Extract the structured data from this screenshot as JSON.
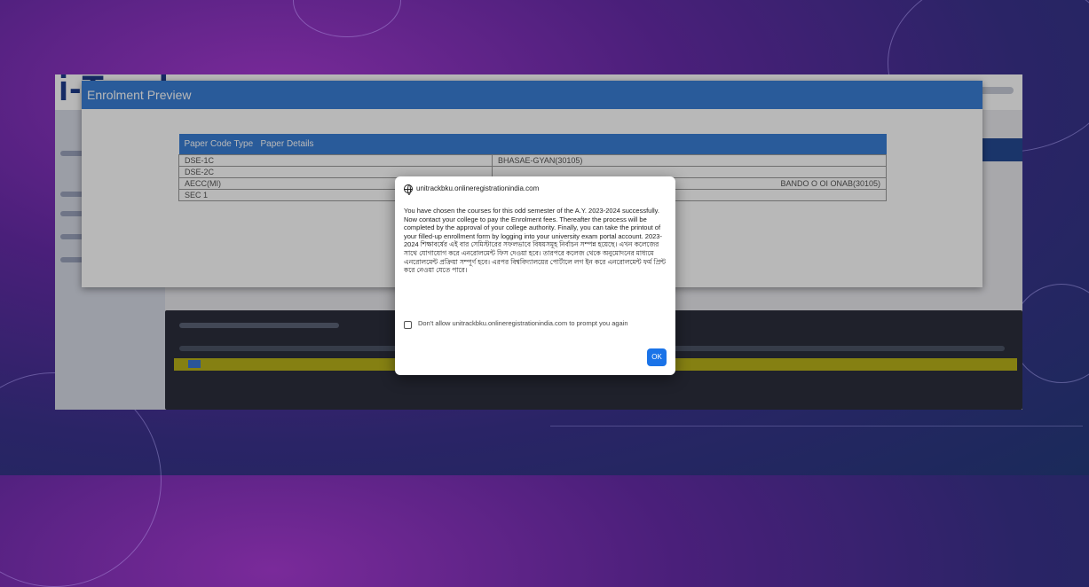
{
  "app": {
    "logo_text": "i-Track"
  },
  "enrolment_preview": {
    "title": "Enrolment Preview",
    "table": {
      "headers": [
        "Paper Code Type",
        "Paper Details"
      ],
      "rows": [
        [
          "DSE-1C",
          "BHASAE-GYAN(30105)"
        ],
        [
          "DSE-2C",
          ""
        ],
        [
          "AECC(MI)",
          "BANDO O OI ONAB(30105)"
        ],
        [
          "SEC 1",
          ""
        ]
      ]
    }
  },
  "alert": {
    "origin": "unitrackbku.onlineregistrationindia.com",
    "message": "You have chosen the courses for this odd semester of the A.Y. 2023-2024 successfully. Now contact your college to pay the Enrolment fees. Thereafter the process will be completed by the approval of your college authority. Finally, you can take the printout of your filled-up enrollment form by logging into your university exam portal account. 2023-2024 শিক্ষাবর্ষের এই বার সেমিস্টারের সফলভাবে বিষয়সমূহ নির্বাচন সম্পন্ন হয়েছে। এখন কলেজের সাথে যোগাযোগ করে এনরোলমেন্ট ফিস দেওয়া হবে। তারপরে কলেজ থেকে অনুমোদনের মাধ্যমে এনরোলমেন্ট প্রক্রিয়া সম্পূর্ণ হবে। এরপর বিশ্ববিদ্যালয়ের পোর্টালে লগ ইন করে এনরোলমেন্ট ফর্ম প্রিন্ট করে নেওয়া যেতে পারে।",
    "checkbox_label": "Don't allow unitrackbku.onlineregistrationindia.com to prompt you again",
    "ok_label": "OK"
  },
  "colors": {
    "accent_blue": "#3a7ed6",
    "ok_button": "#1a73e8",
    "highlight_row": "#b9b21a"
  }
}
